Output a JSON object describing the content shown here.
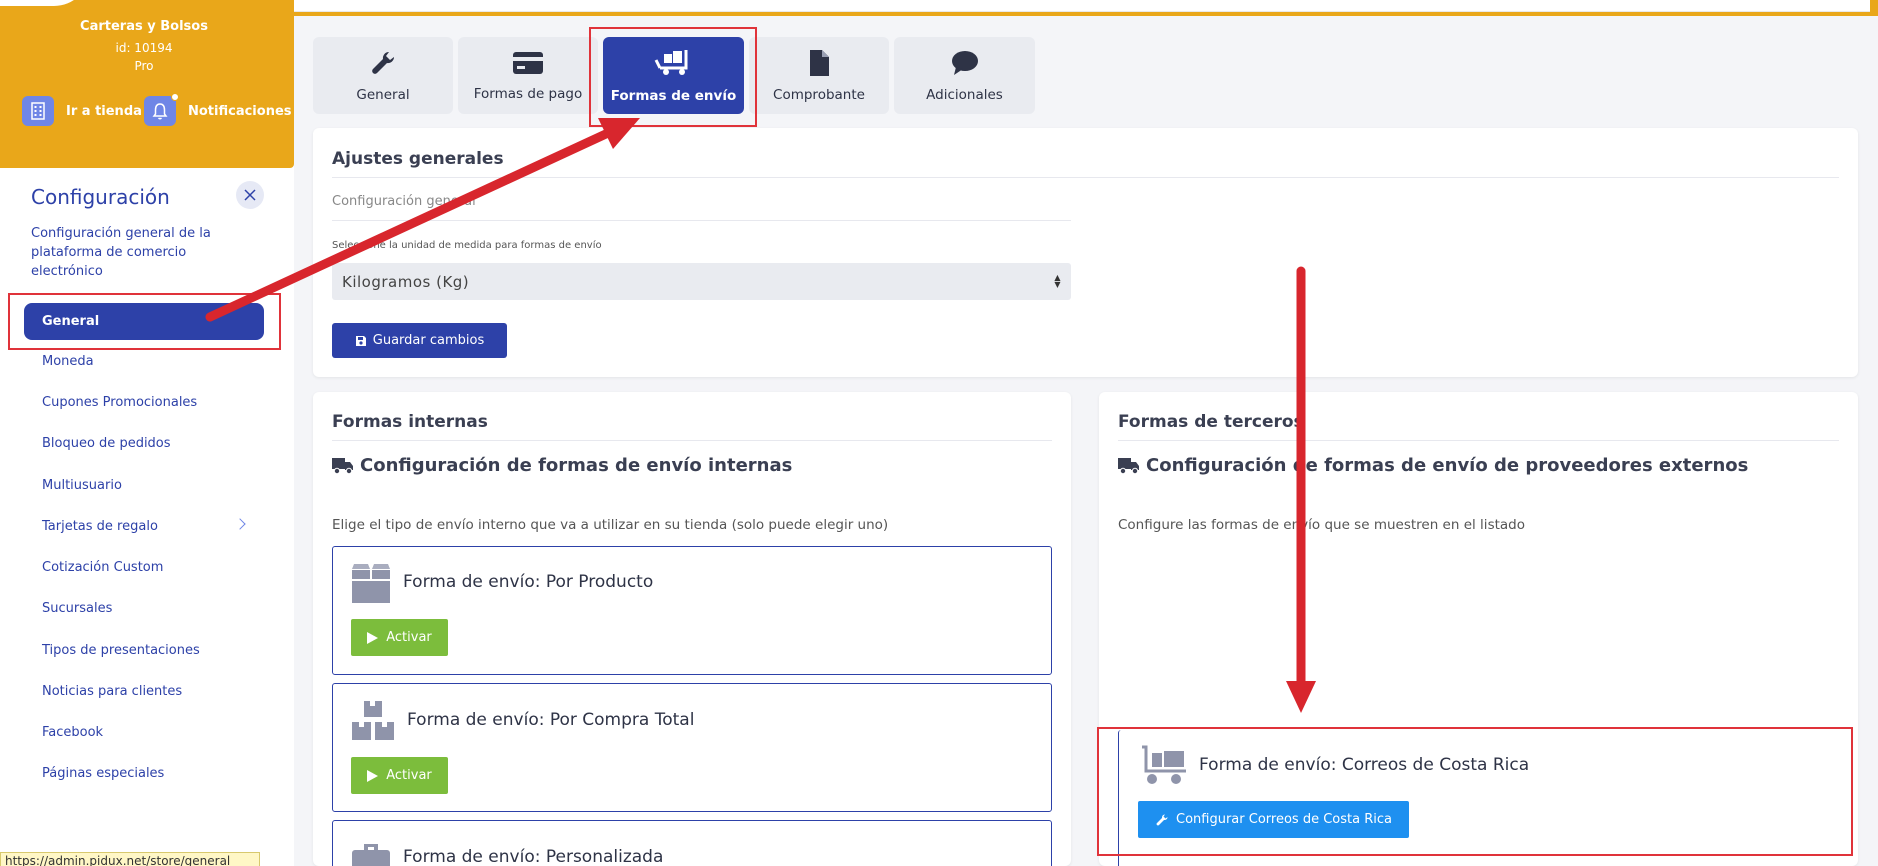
{
  "sidebar": {
    "store_name": "Carteras y Bolsos",
    "store_id": "id: 10194",
    "store_plan": "Pro",
    "go_store_label": "Ir a tienda",
    "notifications_label": "Notificaciones",
    "section_title": "Configuración",
    "section_desc": "Configuración general de la plataforma de comercio electrónico",
    "active_item": "General",
    "items": [
      "Moneda",
      "Cupones Promocionales",
      "Bloqueo de pedidos",
      "Multiusuario",
      "Tarjetas de regalo",
      "Cotización Custom",
      "Sucursales",
      "Tipos de presentaciones",
      "Noticias para clientes",
      "Facebook",
      "Páginas especiales"
    ],
    "status_url": "https://admin.pidux.net/store/general"
  },
  "tabs": [
    {
      "label": "General",
      "icon": "wrench-icon"
    },
    {
      "label": "Formas de pago",
      "icon": "credit-card-icon"
    },
    {
      "label": "Formas de envío",
      "icon": "dolly-icon",
      "active": true
    },
    {
      "label": "Comprobante",
      "icon": "file-icon"
    },
    {
      "label": "Adicionales",
      "icon": "comment-icon"
    }
  ],
  "general_settings": {
    "title": "Ajustes generales",
    "subtitle": "Configuración general",
    "unit_label": "Seleccione la unidad de medida para formas de envío",
    "unit_value": "Kilogramos (Kg)",
    "save_label": "Guardar cambios"
  },
  "internal": {
    "title": "Formas internas",
    "heading": "Configuración de formas de envío internas",
    "desc": "Elige el tipo de envío interno que va a utilizar en su tienda (solo puede elegir uno)",
    "options": [
      {
        "title": "Forma de envío: Por Producto",
        "button": "Activar",
        "icon": "box-icon"
      },
      {
        "title": "Forma de envío: Por Compra Total",
        "button": "Activar",
        "icon": "boxes-icon"
      },
      {
        "title": "Forma de envío: Personalizada",
        "icon": "toolbox-icon"
      }
    ]
  },
  "third_party": {
    "title": "Formas de terceros",
    "heading": "Configuración de formas de envío de proveedores externos",
    "desc": "Configure las formas de envío que se muestren en el listado",
    "option_title": "Forma de envío: Correos de Costa Rica",
    "option_button": "Configurar Correos de Costa Rica"
  },
  "colors": {
    "accent": "#2d41a8",
    "brand": "#e9a71a",
    "activate": "#7cbd3c",
    "configure": "#1e90f0",
    "annotation": "#e0333a"
  }
}
